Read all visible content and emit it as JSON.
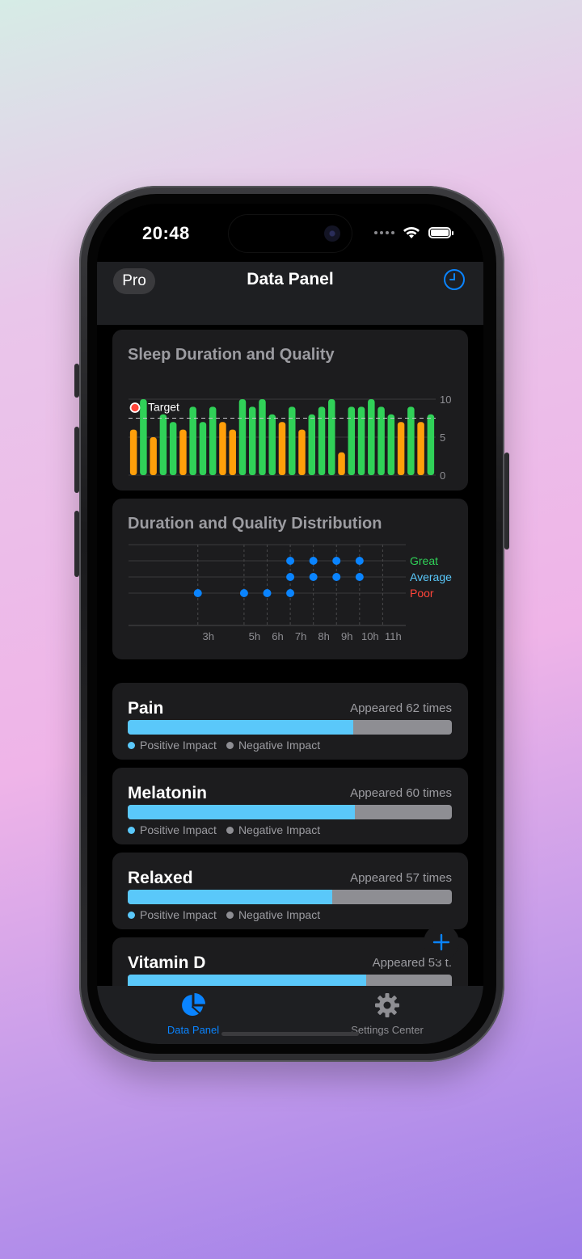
{
  "status": {
    "time": "20:48"
  },
  "nav": {
    "pro_label": "Pro",
    "title": "Data Panel"
  },
  "sleep_card": {
    "title": "Sleep Duration and Quality",
    "target_label": "Target"
  },
  "dist_card": {
    "title": "Duration and Quality Distribution"
  },
  "chart_data": [
    {
      "type": "bar",
      "title": "Sleep Duration and Quality",
      "ylim": [
        0,
        10
      ],
      "y_ticks": [
        0,
        5,
        10
      ],
      "target": 7.5,
      "target_label": "Target",
      "values": [
        6,
        10,
        5,
        8,
        7,
        6,
        9,
        7,
        9,
        7,
        6,
        10,
        9,
        10,
        8,
        7,
        9,
        6,
        8,
        9,
        10,
        3,
        9,
        9,
        10,
        9,
        8,
        7,
        9,
        7,
        8
      ],
      "quality": [
        "poor",
        "good",
        "poor",
        "good",
        "good",
        "poor",
        "good",
        "good",
        "good",
        "poor",
        "poor",
        "good",
        "good",
        "good",
        "good",
        "poor",
        "good",
        "poor",
        "good",
        "good",
        "good",
        "poor",
        "good",
        "good",
        "good",
        "good",
        "good",
        "poor",
        "good",
        "poor",
        "good"
      ],
      "colors": {
        "good": "#30d158",
        "poor": "#ff9f0a"
      }
    },
    {
      "type": "scatter",
      "title": "Duration and Quality Distribution",
      "x_ticks": [
        "3h",
        "5h",
        "6h",
        "7h",
        "8h",
        "9h",
        "10h",
        "11h"
      ],
      "x_tick_values": [
        3,
        5,
        6,
        7,
        8,
        9,
        10,
        11
      ],
      "xlim": [
        0,
        12
      ],
      "categories": [
        "Great",
        "Average",
        "Poor"
      ],
      "category_colors": [
        "#30d158",
        "#5ac8fa",
        "#ff453a"
      ],
      "points": [
        {
          "x": 3,
          "y": "Poor"
        },
        {
          "x": 5,
          "y": "Poor"
        },
        {
          "x": 6,
          "y": "Poor"
        },
        {
          "x": 7,
          "y": "Poor"
        },
        {
          "x": 7,
          "y": "Average"
        },
        {
          "x": 8,
          "y": "Average"
        },
        {
          "x": 9,
          "y": "Average"
        },
        {
          "x": 10,
          "y": "Average"
        },
        {
          "x": 7,
          "y": "Great"
        },
        {
          "x": 8,
          "y": "Great"
        },
        {
          "x": 9,
          "y": "Great"
        },
        {
          "x": 10,
          "y": "Great"
        }
      ],
      "point_color": "#0a84ff"
    }
  ],
  "legend": {
    "positive": "Positive Impact",
    "negative": "Negative Impact"
  },
  "factors": [
    {
      "name": "Pain",
      "count": "Appeared 62 times",
      "positive": 0.695
    },
    {
      "name": "Melatonin",
      "count": "Appeared 60 times",
      "positive": 0.7
    },
    {
      "name": "Relaxed",
      "count": "Appeared 57 times",
      "positive": 0.63
    },
    {
      "name": "Vitamin D",
      "count": "Appeared 53 t.",
      "positive": 0.735
    }
  ],
  "tabs": [
    {
      "label": "Data Panel",
      "active": true,
      "icon": "pie-chart-icon"
    },
    {
      "label": "Settings Center",
      "active": false,
      "icon": "gear-icon"
    }
  ],
  "colors": {
    "accent": "#0a84ff",
    "positive": "#5ac8fa",
    "negative": "#8e8e93"
  }
}
